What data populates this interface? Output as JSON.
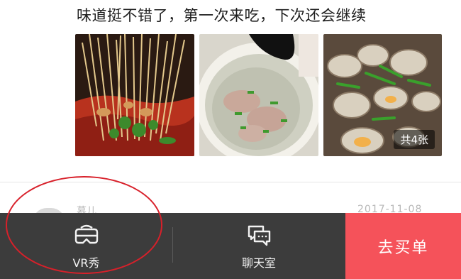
{
  "review": {
    "text": "味道挺不错了，第一次来吃，下次还会继续",
    "photo_count": "共4张"
  },
  "next_review": {
    "user": "慕儿",
    "date": "2017-11-08"
  },
  "bottom_bar": {
    "vr_label": "VR秀",
    "chat_label": "聊天室",
    "pay_label": "去买单"
  },
  "colors": {
    "bar_background": "#3c3c3c",
    "pay_button": "#f5525a",
    "highlight_ring": "#d8202a"
  },
  "icons": {
    "vr": "vr-headset-icon",
    "chat": "chat-bubbles-icon"
  }
}
